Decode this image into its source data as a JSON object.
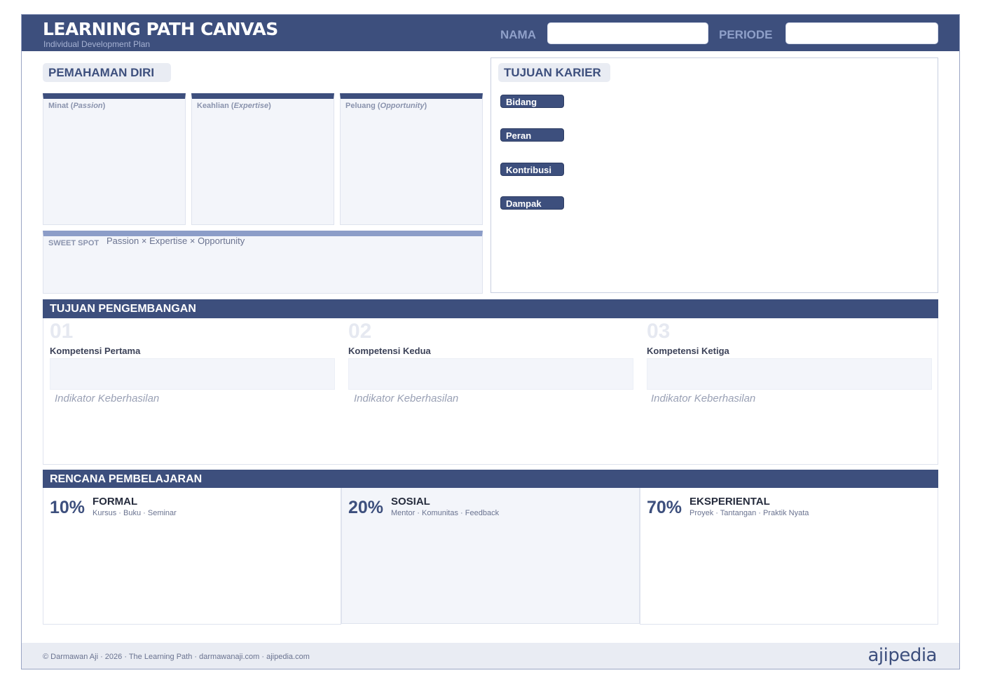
{
  "header": {
    "title": "LEARNING PATH CANVAS",
    "subtitle": "Individual Development Plan",
    "nama_label": "NAMA",
    "nama_value": "",
    "periode_label": "PERIODE",
    "periode_value": ""
  },
  "pemahaman": {
    "title": "PEMAHAMAN DIRI",
    "boxes": [
      {
        "label": "Minat",
        "label_en": "Passion"
      },
      {
        "label": "Keahlian",
        "label_en": "Expertise"
      },
      {
        "label": "Peluang",
        "label_en": "Opportunity"
      }
    ],
    "sweet_spot_label": "SWEET SPOT",
    "sweet_spot_desc": "Passion × Expertise × Opportunity"
  },
  "karier": {
    "title": "TUJUAN KARIER",
    "items": [
      "Bidang",
      "Peran",
      "Kontribusi",
      "Dampak"
    ]
  },
  "pengembangan": {
    "title": "TUJUAN PENGEMBANGAN",
    "goals": [
      {
        "num": "01",
        "name": "Kompetensi Pertama",
        "indicator": "Indikator Keberhasilan"
      },
      {
        "num": "02",
        "name": "Kompetensi Kedua",
        "indicator": "Indikator Keberhasilan"
      },
      {
        "num": "03",
        "name": "Kompetensi Ketiga",
        "indicator": "Indikator Keberhasilan"
      }
    ]
  },
  "pembelajaran": {
    "title": "RENCANA PEMBELAJARAN",
    "plans": [
      {
        "pct": "10%",
        "name": "FORMAL",
        "desc": "Kursus · Buku · Seminar"
      },
      {
        "pct": "20%",
        "name": "SOSIAL",
        "desc": "Mentor · Komunitas · Feedback"
      },
      {
        "pct": "70%",
        "name": "EKSPERIENTAL",
        "desc": "Proyek · Tantangan · Praktik Nyata"
      }
    ]
  },
  "footer": {
    "text": "© Darmawan Aji · 2026 · The Learning Path · darmawanaji.com · ajipedia.com",
    "logo": "ajipedia"
  },
  "colors": {
    "primary": "#3d4f7d",
    "light_panel": "#f3f5fa",
    "sweet_spot_accent": "#8c9dc8"
  }
}
